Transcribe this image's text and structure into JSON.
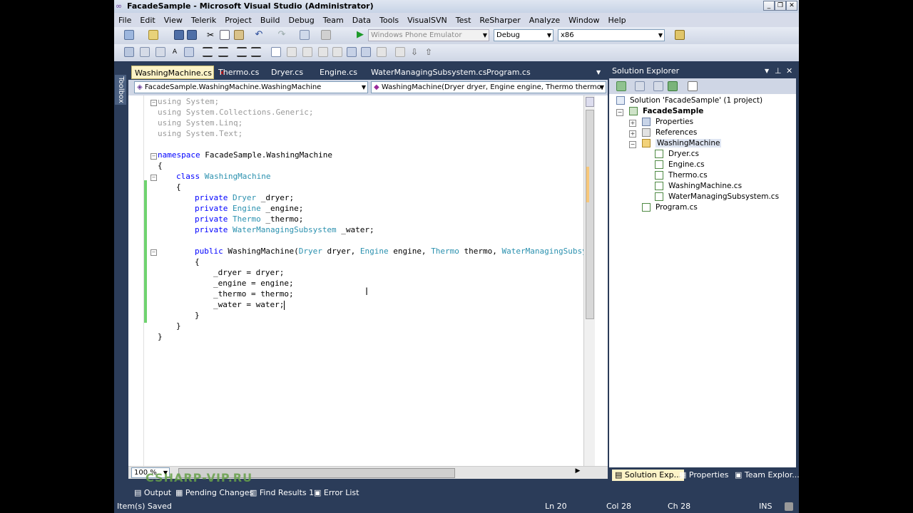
{
  "window": {
    "title": "FacadeSample - Microsoft Visual Studio (Administrator)"
  },
  "menu": [
    "File",
    "Edit",
    "View",
    "Telerik",
    "Project",
    "Build",
    "Debug",
    "Team",
    "Data",
    "Tools",
    "VisualSVN",
    "Test",
    "ReSharper",
    "Analyze",
    "Window",
    "Help"
  ],
  "toolbar": {
    "device_target": "Windows Phone Emulator",
    "configuration": "Debug",
    "platform": "x86"
  },
  "toolbox_label": "Toolbox",
  "tabs": [
    {
      "label": "WashingMachine.cs",
      "active": true
    },
    {
      "label": "Thermo.cs"
    },
    {
      "label": "Dryer.cs"
    },
    {
      "label": "Engine.cs"
    },
    {
      "label": "WaterManagingSubsystem.cs"
    },
    {
      "label": "Program.cs"
    }
  ],
  "nav": {
    "type_combo": "FacadeSample.WashingMachine.WashingMachine",
    "member_combo": "WashingMachine(Dryer dryer, Engine engine, Thermo thermo, Wa"
  },
  "code": {
    "l1a": "using",
    "l1b": " System;",
    "l2a": "using",
    "l2b": " System.Collections.Generic;",
    "l3a": "using",
    "l3b": " System.Linq;",
    "l4a": "using",
    "l4b": " System.Text;",
    "l6a": "namespace",
    "l6b": " FacadeSample.WashingMachine",
    "l7": "{",
    "l8a": "class",
    "l8b": "WashingMachine",
    "l9": "{",
    "l10a": "private",
    "l10b": "Dryer",
    "l10c": " _dryer;",
    "l11a": "private",
    "l11b": "Engine",
    "l11c": " _engine;",
    "l12a": "private",
    "l12b": "Thermo",
    "l12c": " _thermo;",
    "l13a": "private",
    "l13b": "WaterManagingSubsystem",
    "l13c": " _water;",
    "l15a": "public",
    "l15b": " WashingMachine(",
    "l15c": "Dryer",
    "l15d": " dryer, ",
    "l15e": "Engine",
    "l15f": " engine, ",
    "l15g": "Thermo",
    "l15h": " thermo, ",
    "l15i": "WaterManagingSubsy",
    "l16": "{",
    "l17": "_dryer = dryer;",
    "l18": "_engine = engine;",
    "l19": "_thermo = thermo;",
    "l20": "_water = water;",
    "l21": "}",
    "l22": "}",
    "l23": "}"
  },
  "zoom": "100 %",
  "watermark": "CSHARP-VIP.RU",
  "bottom_tabs": [
    "Output",
    "Pending Changes",
    "Find Results 1",
    "Error List"
  ],
  "solution_explorer": {
    "title": "Solution Explorer",
    "solution": "Solution 'FacadeSample' (1 project)",
    "project": "FacadeSample",
    "properties": "Properties",
    "references": "References",
    "folder": "WashingMachine",
    "files": [
      "Dryer.cs",
      "Engine.cs",
      "Thermo.cs",
      "WashingMachine.cs",
      "WaterManagingSubsystem.cs"
    ],
    "program": "Program.cs",
    "tabs": [
      "Solution Exp...",
      "Properties",
      "Team Explor..."
    ]
  },
  "status": {
    "message": "Item(s) Saved",
    "ln": "Ln 20",
    "col": "Col 28",
    "ch": "Ch 28",
    "mode": "INS"
  },
  "colors": {
    "keyword": "#0000ff",
    "type": "#2b91af",
    "chrome": "#2b3c59"
  }
}
